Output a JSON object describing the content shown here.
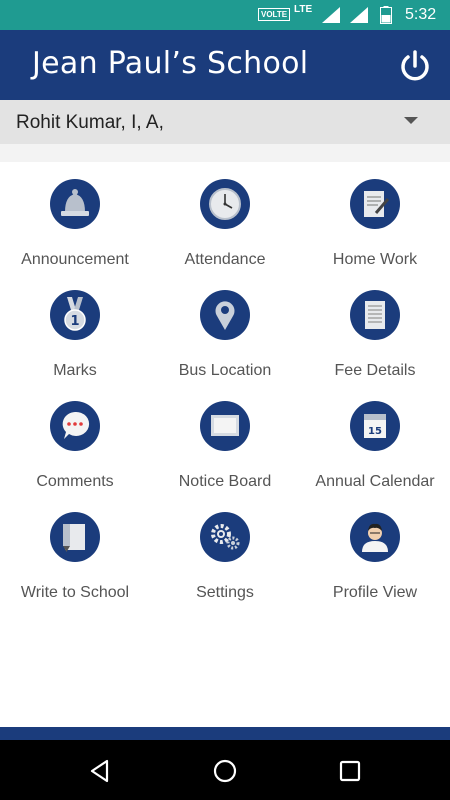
{
  "status_bar": {
    "volte": "VOLTE",
    "network": "LTE",
    "time": "5:32"
  },
  "app_bar": {
    "title": "Jean Paul’s School",
    "power_icon": "power-icon"
  },
  "student_selector": {
    "selected": "Rohit Kumar, I, A,"
  },
  "menu": [
    {
      "label": "Announcement",
      "icon": "bell-icon"
    },
    {
      "label": "Attendance",
      "icon": "clock-icon"
    },
    {
      "label": "Home Work",
      "icon": "notepad-icon"
    },
    {
      "label": "Marks",
      "icon": "medal-icon"
    },
    {
      "label": "Bus Location",
      "icon": "map-pin-icon"
    },
    {
      "label": "Fee Details",
      "icon": "receipt-icon"
    },
    {
      "label": "Comments",
      "icon": "speech-bubble-icon"
    },
    {
      "label": "Notice Board",
      "icon": "board-icon"
    },
    {
      "label": "Annual Calendar",
      "icon": "calendar-icon"
    },
    {
      "label": "Write to School",
      "icon": "write-icon"
    },
    {
      "label": "Settings",
      "icon": "gears-icon"
    },
    {
      "label": "Profile View",
      "icon": "user-avatar-icon"
    }
  ],
  "calendar_day": "15",
  "colors": {
    "status_bar": "#1f9b91",
    "primary": "#1b3c7c",
    "selector_bg": "#e3e3e3",
    "label_text": "#555555"
  }
}
